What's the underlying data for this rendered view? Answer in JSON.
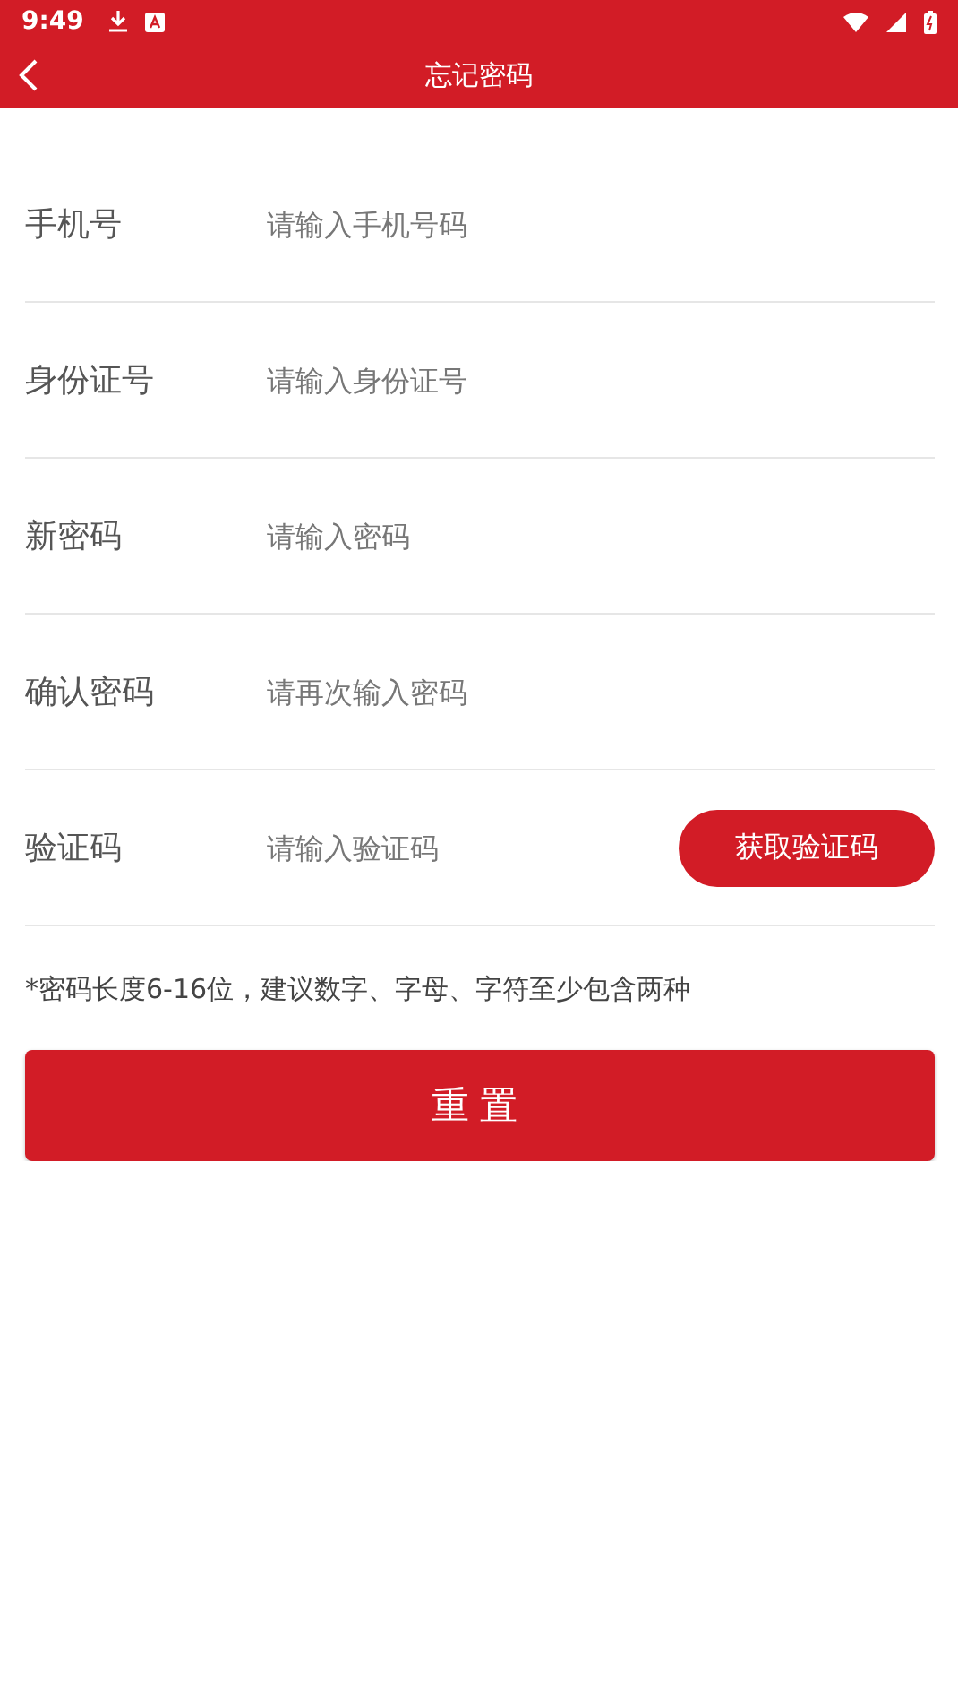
{
  "status_bar": {
    "time": "9:49"
  },
  "header": {
    "title": "忘记密码"
  },
  "fields": [
    {
      "kind": "text",
      "label": "手机号",
      "placeholder": "请输入手机号码"
    },
    {
      "kind": "text",
      "label": "身份证号",
      "placeholder": "请输入身份证号"
    },
    {
      "kind": "text",
      "label": "新密码",
      "placeholder": "请输入密码"
    },
    {
      "kind": "text",
      "label": "确认密码",
      "placeholder": "请再次输入密码"
    },
    {
      "kind": "code",
      "label": "验证码",
      "placeholder": "请输入验证码",
      "button": "获取验证码"
    }
  ],
  "hint": "*密码长度6-16位，建议数字、字母、字符至少包含两种",
  "submit_button": "重置"
}
